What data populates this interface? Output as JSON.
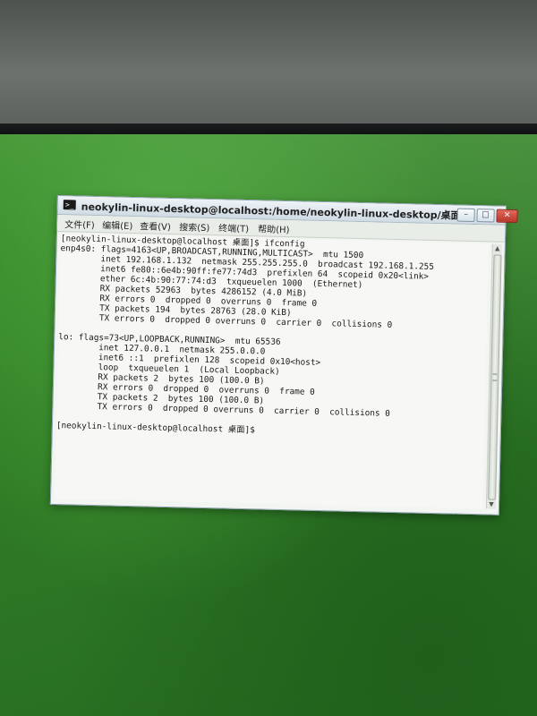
{
  "window": {
    "title": "neokylin-linux-desktop@localhost:/home/neokylin-linux-desktop/桌面",
    "icon": "terminal-icon",
    "controls": {
      "minimize": "–",
      "maximize": "□",
      "close": "✕"
    }
  },
  "menubar": {
    "items": [
      "文件(F)",
      "编辑(E)",
      "查看(V)",
      "搜索(S)",
      "终端(T)",
      "帮助(H)"
    ]
  },
  "terminal": {
    "lines": [
      "[neokylin-linux-desktop@localhost 桌面]$ ifconfig",
      "enp4s0: flags=4163<UP,BROADCAST,RUNNING,MULTICAST>  mtu 1500",
      "        inet 192.168.1.132  netmask 255.255.255.0  broadcast 192.168.1.255",
      "        inet6 fe80::6e4b:90ff:fe77:74d3  prefixlen 64  scopeid 0x20<link>",
      "        ether 6c:4b:90:77:74:d3  txqueuelen 1000  (Ethernet)",
      "        RX packets 52963  bytes 4286152 (4.0 MiB)",
      "        RX errors 0  dropped 0  overruns 0  frame 0",
      "        TX packets 194  bytes 28763 (28.0 KiB)",
      "        TX errors 0  dropped 0 overruns 0  carrier 0  collisions 0",
      "",
      "lo: flags=73<UP,LOOPBACK,RUNNING>  mtu 65536",
      "        inet 127.0.0.1  netmask 255.0.0.0",
      "        inet6 ::1  prefixlen 128  scopeid 0x10<host>",
      "        loop  txqueuelen 1  (Local Loopback)",
      "        RX packets 2  bytes 100 (100.0 B)",
      "        RX errors 0  dropped 0  overruns 0  frame 0",
      "        TX packets 2  bytes 100 (100.0 B)",
      "        TX errors 0  dropped 0 overruns 0  carrier 0  collisions 0",
      "",
      "[neokylin-linux-desktop@localhost 桌面]$"
    ]
  },
  "colors": {
    "desktop": "#2f7c25",
    "terminal_background": "#f7f8f6",
    "terminal_text": "#1a1a1a",
    "close_button": "#c8493b"
  }
}
